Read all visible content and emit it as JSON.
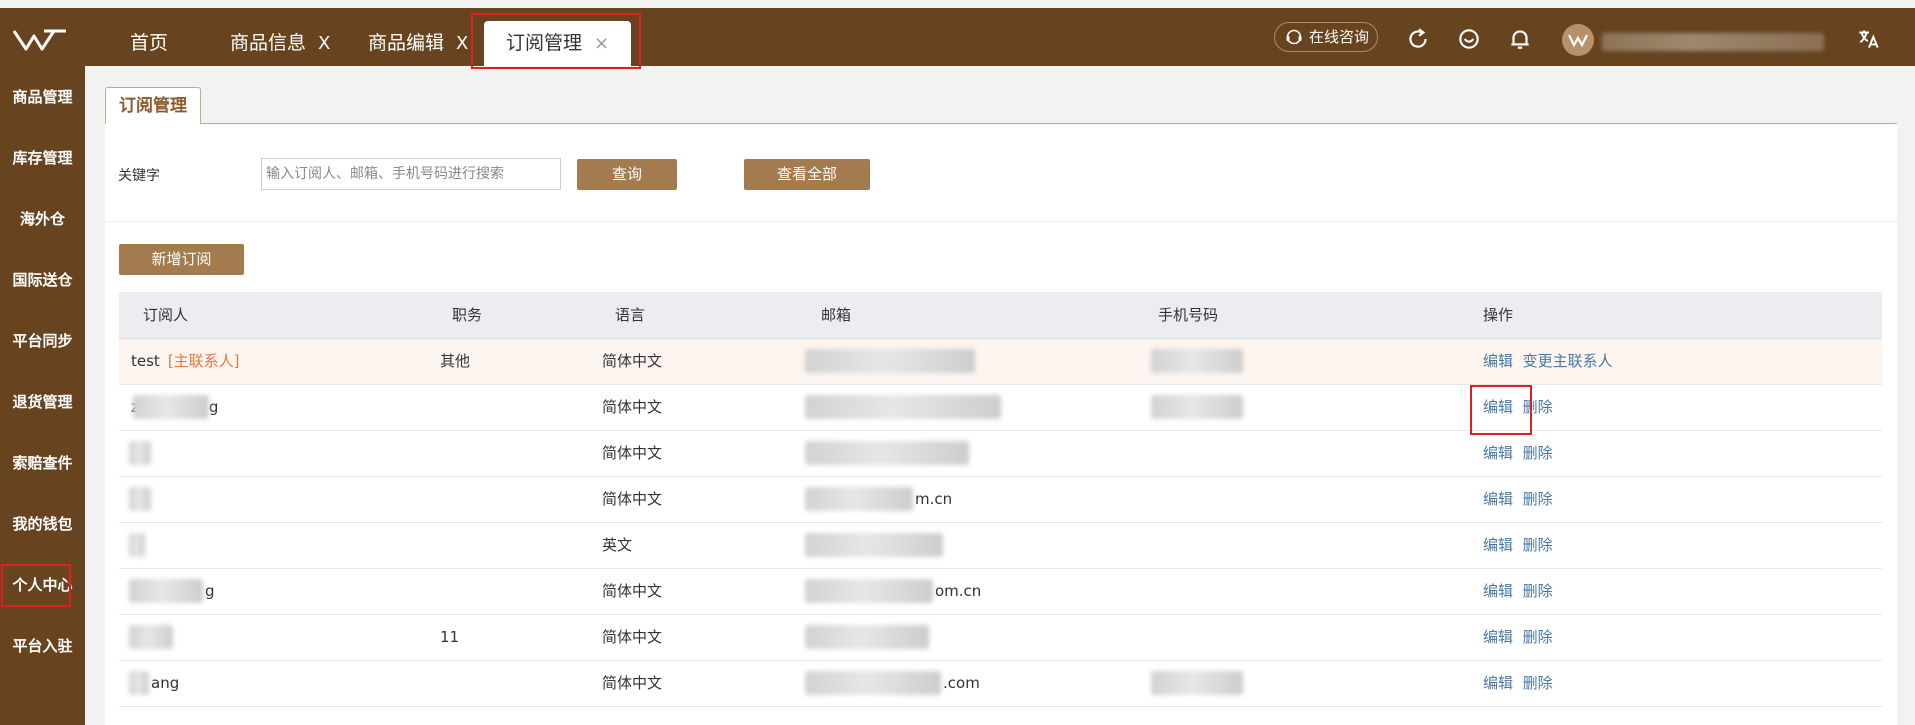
{
  "header": {
    "tabs": [
      {
        "label": "首页",
        "closable": false
      },
      {
        "label": "商品信息",
        "closable": true
      },
      {
        "label": "商品编辑",
        "closable": true
      },
      {
        "label": "订阅管理",
        "closable": true,
        "active": true
      }
    ],
    "close_glyph": "X",
    "consult_label": "在线咨询",
    "icons": [
      "refresh-icon",
      "smile-icon",
      "bell-icon",
      "translate-icon"
    ]
  },
  "sidebar": {
    "items": [
      {
        "label": "商品管理"
      },
      {
        "label": "库存管理"
      },
      {
        "label": "海外仓"
      },
      {
        "label": "国际送仓"
      },
      {
        "label": "平台同步"
      },
      {
        "label": "退货管理"
      },
      {
        "label": "索赔查件"
      },
      {
        "label": "我的钱包"
      },
      {
        "label": "个人中心",
        "highlighted": true
      },
      {
        "label": "平台入驻"
      }
    ]
  },
  "page": {
    "tab_label": "订阅管理",
    "keyword_label": "关键字",
    "search_placeholder": "输入订阅人、邮箱、手机号码进行搜索",
    "query_button": "查询",
    "view_all_button": "查看全部",
    "add_button": "新增订阅"
  },
  "table": {
    "columns": [
      "订阅人",
      "职务",
      "语言",
      "邮箱",
      "手机号码",
      "操作"
    ],
    "rows": [
      {
        "subscriber": "test",
        "tag": "[主联系人]",
        "position": "其他",
        "language": "简体中文",
        "email": "",
        "phone": "",
        "ops": [
          "编辑",
          "变更主联系人"
        ],
        "main": true
      },
      {
        "subscriber": "z",
        "subscriber_tail": "g",
        "position": "",
        "language": "简体中文",
        "email": "",
        "phone": "",
        "ops": [
          "编辑",
          "删除"
        ]
      },
      {
        "subscriber": "",
        "position": "",
        "language": "简体中文",
        "email": "",
        "phone": "",
        "ops": [
          "编辑",
          "删除"
        ]
      },
      {
        "subscriber": "",
        "position": "",
        "language": "简体中文",
        "email": "m.cn",
        "phone": "",
        "ops": [
          "编辑",
          "删除"
        ]
      },
      {
        "subscriber": "",
        "position": "",
        "language": "英文",
        "email": "",
        "phone": "",
        "ops": [
          "编辑",
          "删除"
        ]
      },
      {
        "subscriber": "g",
        "position": "",
        "language": "简体中文",
        "email": "om.cn",
        "phone": "",
        "ops": [
          "编辑",
          "删除"
        ]
      },
      {
        "subscriber": "",
        "position": "11",
        "language": "简体中文",
        "email": "",
        "phone": "",
        "ops": [
          "编辑",
          "删除"
        ]
      },
      {
        "subscriber": "ang",
        "position": "",
        "language": "简体中文",
        "email": ".com",
        "phone": "",
        "ops": [
          "编辑",
          "删除"
        ]
      }
    ]
  },
  "colors": {
    "header_bg": "#67431f",
    "button_bg": "#a47b4f",
    "link": "#4a78a6",
    "tag": "#e07a3f",
    "highlight": "#e02020"
  }
}
